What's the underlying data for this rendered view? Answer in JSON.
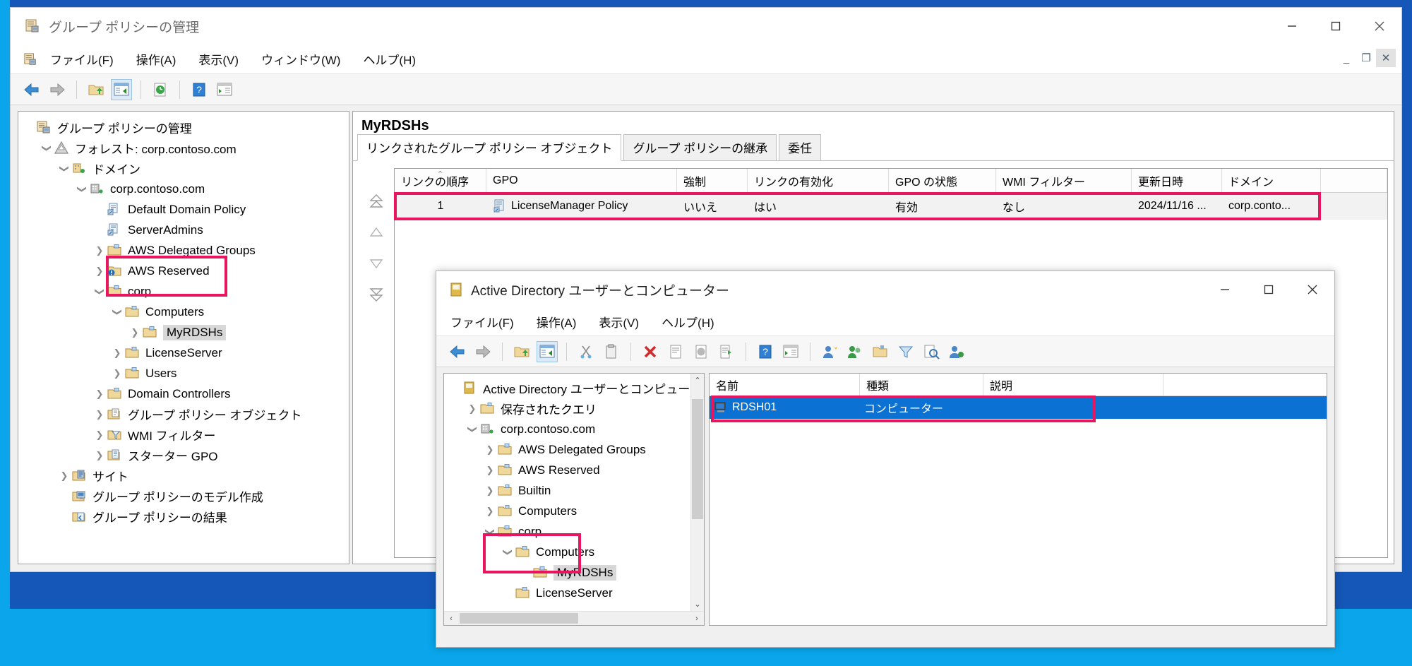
{
  "gpmc": {
    "title": "グループ ポリシーの管理",
    "menu": [
      "ファイル(F)",
      "操作(A)",
      "表示(V)",
      "ウィンドウ(W)",
      "ヘルプ(H)"
    ],
    "window_controls": {
      "minimize": "—",
      "maximize": "□",
      "close": "✕"
    },
    "mdi_controls": {
      "minimize": "_",
      "restore": "❐",
      "close": "✕"
    },
    "tree": [
      {
        "label": "グループ ポリシーの管理",
        "indent": 0,
        "expander": "",
        "icon": "gpmc-console-icon",
        "selected": false
      },
      {
        "label": "フォレスト: corp.contoso.com",
        "indent": 1,
        "expander": "v",
        "icon": "forest-icon",
        "selected": false
      },
      {
        "label": "ドメイン",
        "indent": 2,
        "expander": "v",
        "icon": "domains-icon",
        "selected": false
      },
      {
        "label": "corp.contoso.com",
        "indent": 3,
        "expander": "v",
        "icon": "domain-icon",
        "selected": false
      },
      {
        "label": "Default Domain Policy",
        "indent": 4,
        "expander": "",
        "icon": "gpo-link-icon",
        "selected": false
      },
      {
        "label": "ServerAdmins",
        "indent": 4,
        "expander": "",
        "icon": "gpo-link-icon",
        "selected": false
      },
      {
        "label": "AWS Delegated Groups",
        "indent": 4,
        "expander": ">",
        "icon": "ou-icon",
        "selected": false
      },
      {
        "label": "AWS Reserved",
        "indent": 4,
        "expander": ">",
        "icon": "ou-alert-icon",
        "selected": false
      },
      {
        "label": "corp",
        "indent": 4,
        "expander": "v",
        "icon": "ou-icon",
        "selected": false
      },
      {
        "label": "Computers",
        "indent": 5,
        "expander": "v",
        "icon": "ou-icon",
        "selected": false
      },
      {
        "label": "MyRDSHs",
        "indent": 6,
        "expander": ">",
        "icon": "ou-icon",
        "selected": true
      },
      {
        "label": "LicenseServer",
        "indent": 5,
        "expander": ">",
        "icon": "ou-icon",
        "selected": false
      },
      {
        "label": "Users",
        "indent": 5,
        "expander": ">",
        "icon": "ou-icon",
        "selected": false
      },
      {
        "label": "Domain Controllers",
        "indent": 4,
        "expander": ">",
        "icon": "ou-icon",
        "selected": false
      },
      {
        "label": "グループ ポリシー オブジェクト",
        "indent": 4,
        "expander": ">",
        "icon": "gpo-folder-icon",
        "selected": false
      },
      {
        "label": "WMI フィルター",
        "indent": 4,
        "expander": ">",
        "icon": "wmi-filter-icon",
        "selected": false
      },
      {
        "label": "スターター GPO",
        "indent": 4,
        "expander": ">",
        "icon": "starter-gpo-icon",
        "selected": false
      },
      {
        "label": "サイト",
        "indent": 2,
        "expander": ">",
        "icon": "sites-icon",
        "selected": false
      },
      {
        "label": "グループ ポリシーのモデル作成",
        "indent": 2,
        "expander": "",
        "icon": "modeling-icon",
        "selected": false
      },
      {
        "label": "グループ ポリシーの結果",
        "indent": 2,
        "expander": "",
        "icon": "results-icon",
        "selected": false
      }
    ],
    "content": {
      "header": "MyRDSHs",
      "tabs": [
        {
          "label": "リンクされたグループ ポリシー オブジェクト",
          "active": true
        },
        {
          "label": "グループ ポリシーの継承",
          "active": false
        },
        {
          "label": "委任",
          "active": false
        }
      ],
      "columns": [
        "リンクの順序",
        "GPO",
        "強制",
        "リンクの有効化",
        "GPO の状態",
        "WMI フィルター",
        "更新日時",
        "ドメイン"
      ],
      "sort_indicator_column": "リンクの順序",
      "rows": [
        {
          "link_order": "1",
          "gpo": "LicenseManager Policy",
          "enforced": "いいえ",
          "link_enabled": "はい",
          "gpo_status": "有効",
          "wmi_filter": "なし",
          "modified": "2024/11/16 ...",
          "domain": "corp.conto..."
        }
      ],
      "sort_buttons": [
        "move-to-top",
        "move-up",
        "move-down",
        "move-to-bottom"
      ]
    }
  },
  "aduc": {
    "title": "Active Directory ユーザーとコンピューター",
    "menu": [
      "ファイル(F)",
      "操作(A)",
      "表示(V)",
      "ヘルプ(H)"
    ],
    "window_controls": {
      "minimize": "—",
      "maximize": "□",
      "close": "✕"
    },
    "tree": [
      {
        "label": "Active Directory ユーザーとコンピューター [IP.",
        "indent": 0,
        "expander": "",
        "icon": "aduc-console-icon",
        "selected": false
      },
      {
        "label": "保存されたクエリ",
        "indent": 1,
        "expander": ">",
        "icon": "saved-queries-icon",
        "selected": false
      },
      {
        "label": "corp.contoso.com",
        "indent": 1,
        "expander": "v",
        "icon": "domain-icon",
        "selected": false
      },
      {
        "label": "AWS Delegated Groups",
        "indent": 2,
        "expander": ">",
        "icon": "ou-icon",
        "selected": false
      },
      {
        "label": "AWS Reserved",
        "indent": 2,
        "expander": ">",
        "icon": "ou-icon",
        "selected": false
      },
      {
        "label": "Builtin",
        "indent": 2,
        "expander": ">",
        "icon": "container-icon",
        "selected": false
      },
      {
        "label": "Computers",
        "indent": 2,
        "expander": ">",
        "icon": "container-icon",
        "selected": false
      },
      {
        "label": "corp",
        "indent": 2,
        "expander": "v",
        "icon": "ou-icon",
        "selected": false
      },
      {
        "label": "Computers",
        "indent": 3,
        "expander": "v",
        "icon": "ou-icon",
        "selected": false
      },
      {
        "label": "MyRDSHs",
        "indent": 4,
        "expander": "",
        "icon": "ou-icon",
        "selected": true
      },
      {
        "label": "LicenseServer",
        "indent": 3,
        "expander": "",
        "icon": "ou-icon",
        "selected": false
      }
    ],
    "list": {
      "columns": [
        "名前",
        "種類",
        "説明"
      ],
      "rows": [
        {
          "name": "RDSH01",
          "type": "コンピューター",
          "description": "",
          "selected": true,
          "icon": "computer-icon"
        }
      ]
    },
    "scroll": {
      "up_arrow": "⌃",
      "down_arrow": "⌄",
      "left_arrow": "‹",
      "right_arrow": "›"
    }
  },
  "colors": {
    "highlight": "#e8155f",
    "selection": "#0b72d4",
    "accent": "#0078d7",
    "desktop": "#1557b8"
  }
}
